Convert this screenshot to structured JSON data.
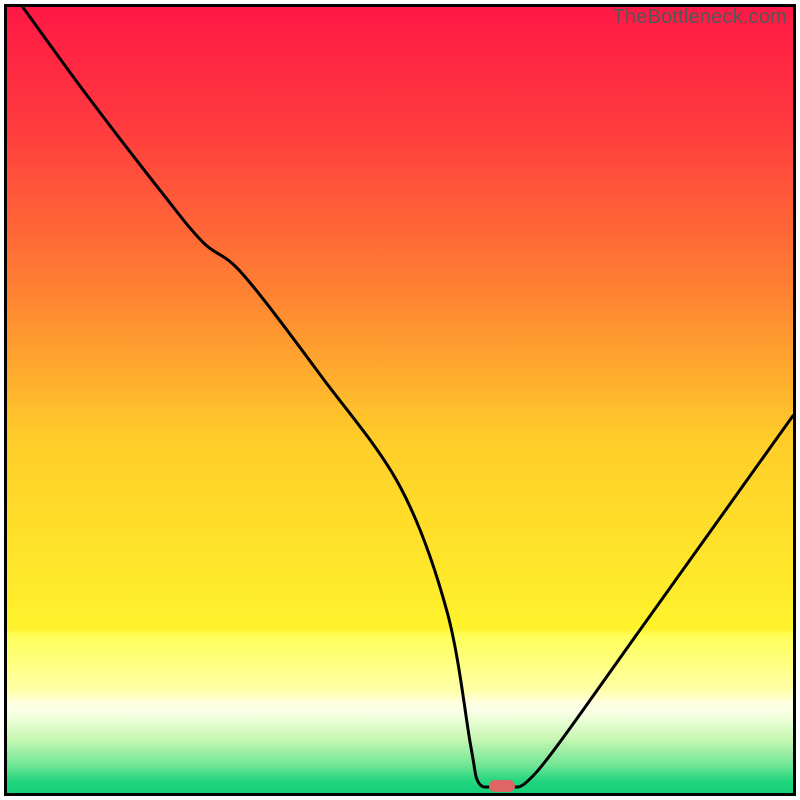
{
  "watermark": "TheBottleneck.com",
  "chart_data": {
    "type": "line",
    "title": "",
    "xlabel": "",
    "ylabel": "",
    "xlim": [
      0,
      100
    ],
    "ylim": [
      0,
      100
    ],
    "series": [
      {
        "name": "curve",
        "x": [
          2,
          10,
          20,
          25,
          30,
          40,
          50,
          56,
          59,
          60,
          62,
          64,
          66,
          70,
          80,
          90,
          100
        ],
        "y": [
          100,
          89,
          76,
          70,
          66,
          53,
          39,
          23,
          6,
          1.3,
          0.8,
          0.8,
          1.3,
          6,
          20,
          34,
          48
        ]
      }
    ],
    "marker": {
      "x": 63,
      "y": 0.9,
      "color": "#e06666"
    },
    "gradient_stops": [
      {
        "pos": 0.0,
        "color": "#ff1846"
      },
      {
        "pos": 0.15,
        "color": "#ff3a3e"
      },
      {
        "pos": 0.35,
        "color": "#ff7d33"
      },
      {
        "pos": 0.55,
        "color": "#ffcd2a"
      },
      {
        "pos": 0.7,
        "color": "#ffe42a"
      },
      {
        "pos": 0.79,
        "color": "#fff22c"
      },
      {
        "pos": 0.8,
        "color": "#ffff5a"
      },
      {
        "pos": 0.87,
        "color": "#ffffa8"
      },
      {
        "pos": 0.885,
        "color": "#ffffe0"
      },
      {
        "pos": 0.895,
        "color": "#fbffe8"
      },
      {
        "pos": 0.93,
        "color": "#caf8b4"
      },
      {
        "pos": 0.965,
        "color": "#6fe595"
      },
      {
        "pos": 0.985,
        "color": "#22d57e"
      },
      {
        "pos": 1.0,
        "color": "#16d07a"
      }
    ]
  }
}
